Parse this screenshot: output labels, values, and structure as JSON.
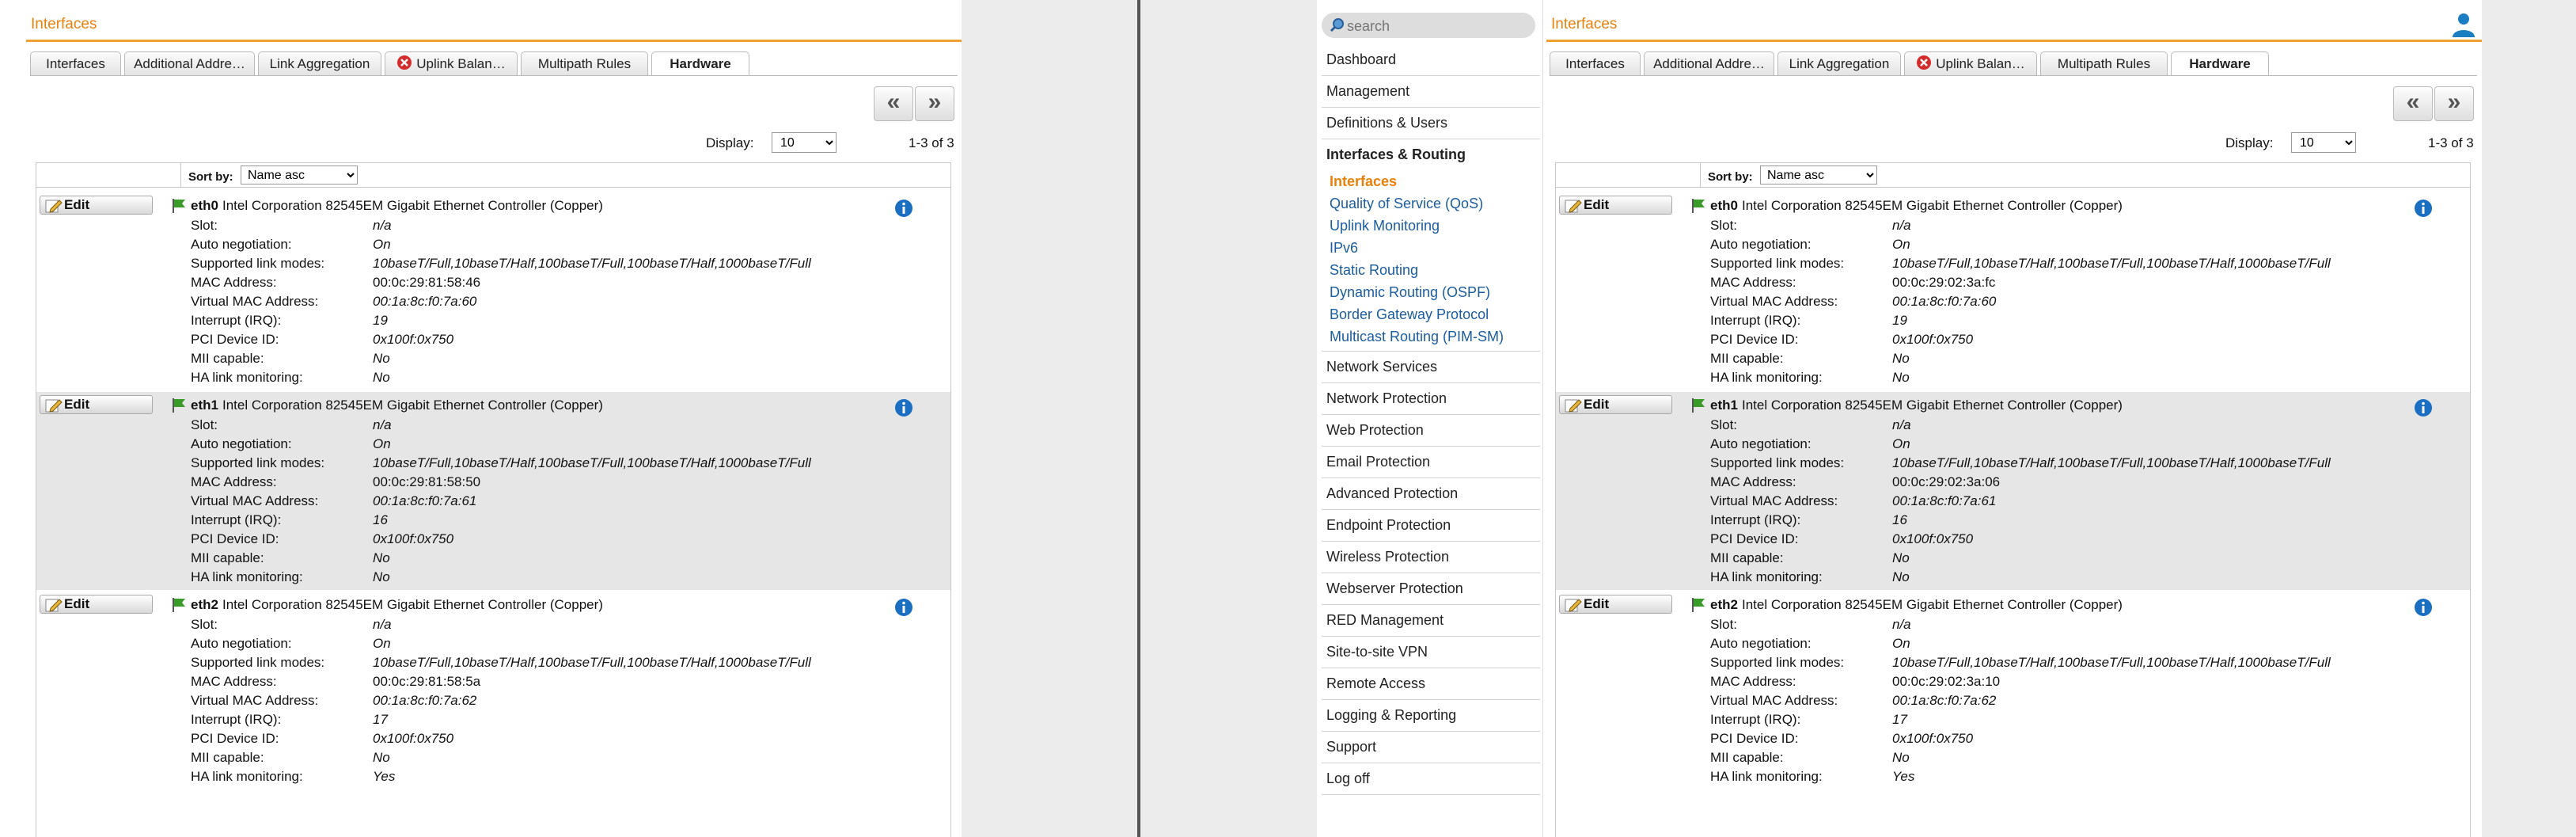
{
  "title": "Interfaces",
  "tabs": [
    "Interfaces",
    "Additional Addre…",
    "Link Aggregation",
    "Uplink Balan…",
    "Multipath Rules",
    "Hardware"
  ],
  "active_tab": "Hardware",
  "pager": {
    "first": "«",
    "prev": "»"
  },
  "display": {
    "label": "Display:",
    "value": "10"
  },
  "count": "1-3 of 3",
  "sort": {
    "label": "Sort by:",
    "value": "Name asc"
  },
  "edit_label": "Edit",
  "search_placeholder": "search",
  "colors": {
    "accent": "#e8810a",
    "link": "#1a5c9e",
    "info": "#1a6fc2",
    "flag": "#3a9a2a"
  },
  "property_labels": [
    "Slot:",
    "Auto negotiation:",
    "Supported link modes:",
    "MAC Address:",
    "Virtual MAC Address:",
    "Interrupt (IRQ):",
    "PCI Device ID:",
    "MII capable:",
    "HA link monitoring:"
  ],
  "menu": {
    "items_before": [
      "Dashboard",
      "Management",
      "Definitions & Users"
    ],
    "open_section": "Interfaces & Routing",
    "subitems": [
      "Interfaces",
      "Quality of Service (QoS)",
      "Uplink Monitoring",
      "IPv6",
      "Static Routing",
      "Dynamic Routing (OSPF)",
      "Border Gateway Protocol",
      "Multicast Routing (PIM-SM)"
    ],
    "active_subitem": "Interfaces",
    "items_after": [
      "Network Services",
      "Network Protection",
      "Web Protection",
      "Email Protection",
      "Advanced Protection",
      "Endpoint Protection",
      "Wireless Protection",
      "Webserver Protection",
      "RED Management",
      "Site-to-site VPN",
      "Remote Access",
      "Logging & Reporting",
      "Support",
      "Log off"
    ]
  },
  "left": {
    "interfaces": [
      {
        "name": "eth0",
        "desc": "Intel Corporation 82545EM Gigabit Ethernet Controller (Copper)",
        "slot": "n/a",
        "auto": "On",
        "modes": "10baseT/Full,10baseT/Half,100baseT/Full,100baseT/Half,1000baseT/Full",
        "mac": "00:0c:29:81:58:46",
        "vmac": "00:1a:8c:f0:7a:60",
        "irq": "19",
        "pci": "0x100f:0x750",
        "mii": "No",
        "ha": "No"
      },
      {
        "name": "eth1",
        "desc": "Intel Corporation 82545EM Gigabit Ethernet Controller (Copper)",
        "slot": "n/a",
        "auto": "On",
        "modes": "10baseT/Full,10baseT/Half,100baseT/Full,100baseT/Half,1000baseT/Full",
        "mac": "00:0c:29:81:58:50",
        "vmac": "00:1a:8c:f0:7a:61",
        "irq": "16",
        "pci": "0x100f:0x750",
        "mii": "No",
        "ha": "No"
      },
      {
        "name": "eth2",
        "desc": "Intel Corporation 82545EM Gigabit Ethernet Controller (Copper)",
        "slot": "n/a",
        "auto": "On",
        "modes": "10baseT/Full,10baseT/Half,100baseT/Full,100baseT/Half,1000baseT/Full",
        "mac": "00:0c:29:81:58:5a",
        "vmac": "00:1a:8c:f0:7a:62",
        "irq": "17",
        "pci": "0x100f:0x750",
        "mii": "No",
        "ha": "Yes"
      }
    ]
  },
  "right": {
    "interfaces": [
      {
        "name": "eth0",
        "desc": "Intel Corporation 82545EM Gigabit Ethernet Controller (Copper)",
        "slot": "n/a",
        "auto": "On",
        "modes": "10baseT/Full,10baseT/Half,100baseT/Full,100baseT/Half,1000baseT/Full",
        "mac": "00:0c:29:02:3a:fc",
        "vmac": "00:1a:8c:f0:7a:60",
        "irq": "19",
        "pci": "0x100f:0x750",
        "mii": "No",
        "ha": "No"
      },
      {
        "name": "eth1",
        "desc": "Intel Corporation 82545EM Gigabit Ethernet Controller (Copper)",
        "slot": "n/a",
        "auto": "On",
        "modes": "10baseT/Full,10baseT/Half,100baseT/Full,100baseT/Half,1000baseT/Full",
        "mac": "00:0c:29:02:3a:06",
        "vmac": "00:1a:8c:f0:7a:61",
        "irq": "16",
        "pci": "0x100f:0x750",
        "mii": "No",
        "ha": "No"
      },
      {
        "name": "eth2",
        "desc": "Intel Corporation 82545EM Gigabit Ethernet Controller (Copper)",
        "slot": "n/a",
        "auto": "On",
        "modes": "10baseT/Full,10baseT/Half,100baseT/Full,100baseT/Half,1000baseT/Full",
        "mac": "00:0c:29:02:3a:10",
        "vmac": "00:1a:8c:f0:7a:62",
        "irq": "17",
        "pci": "0x100f:0x750",
        "mii": "No",
        "ha": "Yes"
      }
    ]
  }
}
